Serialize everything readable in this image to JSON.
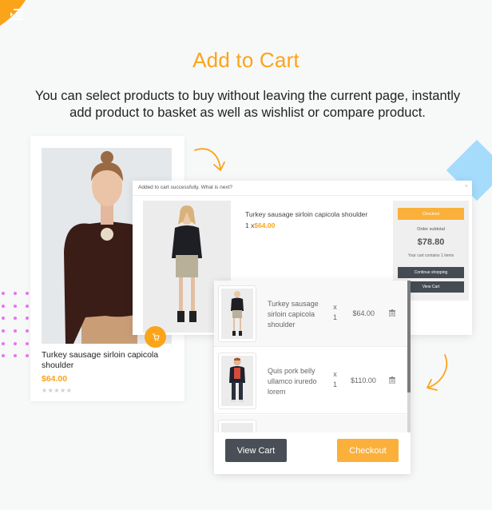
{
  "header": {
    "menu_icon": "menu-indent-icon",
    "title": "Add to Cart",
    "subtitle": "You can select products to buy without leaving the current page, instantly add product to basket as well as wishlist or compare product."
  },
  "colors": {
    "accent": "#fba41a",
    "button_dark": "#454b53",
    "button_orange": "#fbb03b",
    "diamond": "#a5dbfb",
    "dots": "#e574ed"
  },
  "product_card": {
    "name": "Turkey sausage sirloin capicola shoulder",
    "price": "$64.00",
    "rating_stars": "★★★★★",
    "rating": 0,
    "cart_icon": "cart-icon"
  },
  "popup": {
    "message": "Added to cart successfully. What is next?",
    "close": "×",
    "product_name": "Turkey sausage sirloin capicola shoulder",
    "qty_prefix": "1 x",
    "price": "$64.00",
    "checkout_label": "Checkout",
    "subtotal_label": "Order subtotal",
    "subtotal": "$78.80",
    "count_text": "Your cart contains 1 items",
    "continue_label": "Continue shopping",
    "view_cart_label": "View Cart"
  },
  "minicart": {
    "items": [
      {
        "name": "Turkey sausage sirloin capicola shoulder",
        "x": "x",
        "qty": "1",
        "price": "$64.00"
      },
      {
        "name": "Quis pork belly ullamco iruredo lorem",
        "x": "x",
        "qty": "1",
        "price": "$110.00"
      }
    ],
    "view_cart_label": "View Cart",
    "checkout_label": "Checkout"
  }
}
